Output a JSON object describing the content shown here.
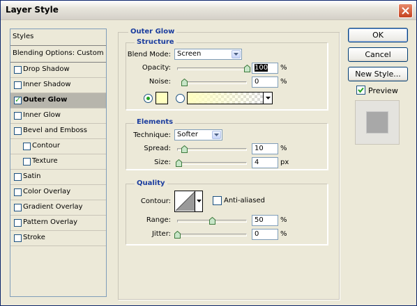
{
  "window": {
    "title": "Layer Style"
  },
  "styles_list": {
    "header": "Styles",
    "blending": "Blending Options: Custom",
    "items": [
      {
        "label": "Drop Shadow",
        "checked": false,
        "indent": false,
        "selected": false
      },
      {
        "label": "Inner Shadow",
        "checked": false,
        "indent": false,
        "selected": false
      },
      {
        "label": "Outer Glow",
        "checked": true,
        "indent": false,
        "selected": true
      },
      {
        "label": "Inner Glow",
        "checked": false,
        "indent": false,
        "selected": false
      },
      {
        "label": "Bevel and Emboss",
        "checked": false,
        "indent": false,
        "selected": false
      },
      {
        "label": "Contour",
        "checked": false,
        "indent": true,
        "selected": false
      },
      {
        "label": "Texture",
        "checked": false,
        "indent": true,
        "selected": false
      },
      {
        "label": "Satin",
        "checked": false,
        "indent": false,
        "selected": false
      },
      {
        "label": "Color Overlay",
        "checked": false,
        "indent": false,
        "selected": false
      },
      {
        "label": "Gradient Overlay",
        "checked": false,
        "indent": false,
        "selected": false
      },
      {
        "label": "Pattern Overlay",
        "checked": false,
        "indent": false,
        "selected": false
      },
      {
        "label": "Stroke",
        "checked": false,
        "indent": false,
        "selected": false
      }
    ]
  },
  "panel": {
    "title": "Outer Glow"
  },
  "structure": {
    "title": "Structure",
    "blend_mode_label": "Blend Mode:",
    "blend_mode_value": "Screen",
    "opacity_label": "Opacity:",
    "opacity_value": "100",
    "opacity_unit": "%",
    "opacity_level": 1.0,
    "noise_label": "Noise:",
    "noise_value": "0",
    "noise_unit": "%",
    "noise_level": 0.0,
    "glow_color": "#FFFFC0",
    "color_mode": "solid"
  },
  "elements": {
    "title": "Elements",
    "technique_label": "Technique:",
    "technique_value": "Softer",
    "spread_label": "Spread:",
    "spread_value": "10",
    "spread_unit": "%",
    "spread_level": 0.1,
    "size_label": "Size:",
    "size_value": "4",
    "size_unit": "px",
    "size_level": 0.02
  },
  "quality": {
    "title": "Quality",
    "contour_label": "Contour:",
    "antialiased_label": "Anti-aliased",
    "antialiased": false,
    "range_label": "Range:",
    "range_value": "50",
    "range_unit": "%",
    "range_level": 0.5,
    "jitter_label": "Jitter:",
    "jitter_value": "0",
    "jitter_unit": "%",
    "jitter_level": 0.0
  },
  "buttons": {
    "ok": "OK",
    "cancel": "Cancel",
    "new_style": "New Style..."
  },
  "preview": {
    "label": "Preview",
    "checked": true
  }
}
